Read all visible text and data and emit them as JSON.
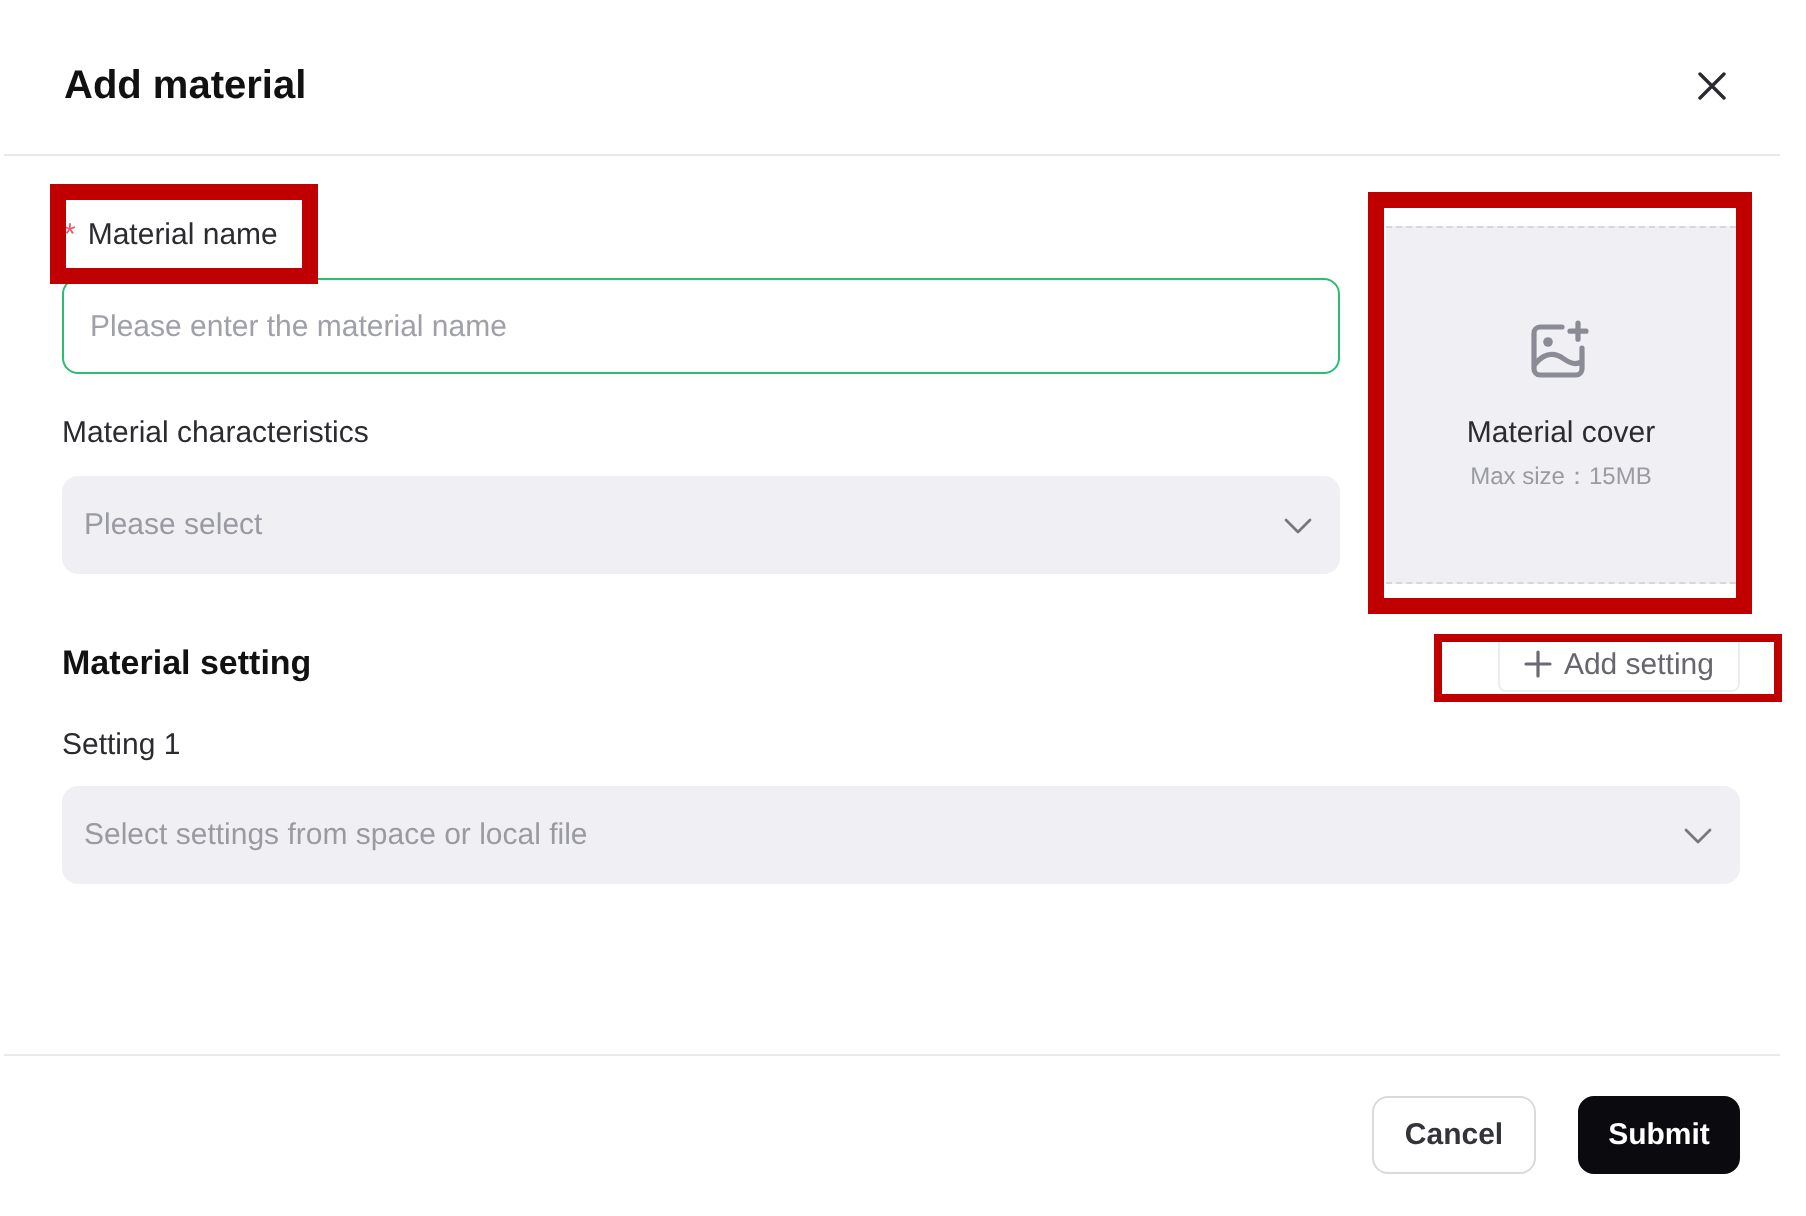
{
  "dialog": {
    "title": "Add material"
  },
  "fields": [
    {
      "kind": "input",
      "required_mark": "*",
      "label": "Material name",
      "placeholder": "Please enter the material name",
      "focused": true,
      "highlighted": true
    },
    {
      "kind": "select",
      "label": "Material characteristics",
      "placeholder": "Please select",
      "focused": false,
      "highlighted": false
    }
  ],
  "cover": {
    "label": "Material cover",
    "hint": "Max size：15MB",
    "highlighted": true
  },
  "settings_section": {
    "title": "Material setting",
    "add_button": {
      "label": "Add setting",
      "highlighted": true
    },
    "settings": [
      {
        "label": "Setting 1",
        "placeholder": "Select settings from space or local file"
      }
    ]
  },
  "footer": {
    "buttons": [
      {
        "kind": "secondary",
        "label": "Cancel"
      },
      {
        "kind": "primary",
        "label": "Submit"
      }
    ]
  }
}
